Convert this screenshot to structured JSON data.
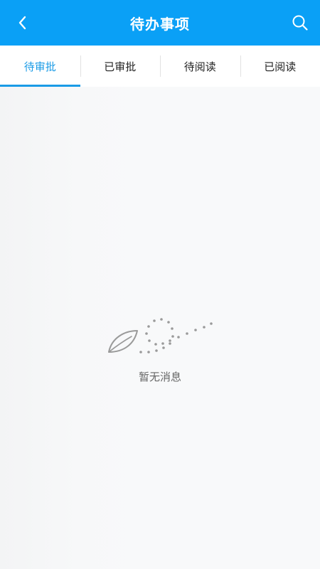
{
  "header": {
    "title": "待办事项",
    "back_icon": "chevron-left-icon",
    "search_icon": "search-icon",
    "background": "#0aa0f6"
  },
  "tabs": [
    {
      "label": "待审批",
      "active": true
    },
    {
      "label": "已审批",
      "active": false
    },
    {
      "label": "待阅读",
      "active": false
    },
    {
      "label": "已阅读",
      "active": false
    }
  ],
  "accent_color": "#1a9be6",
  "empty_state": {
    "icon": "leaf-icon",
    "text": "暂无消息"
  }
}
